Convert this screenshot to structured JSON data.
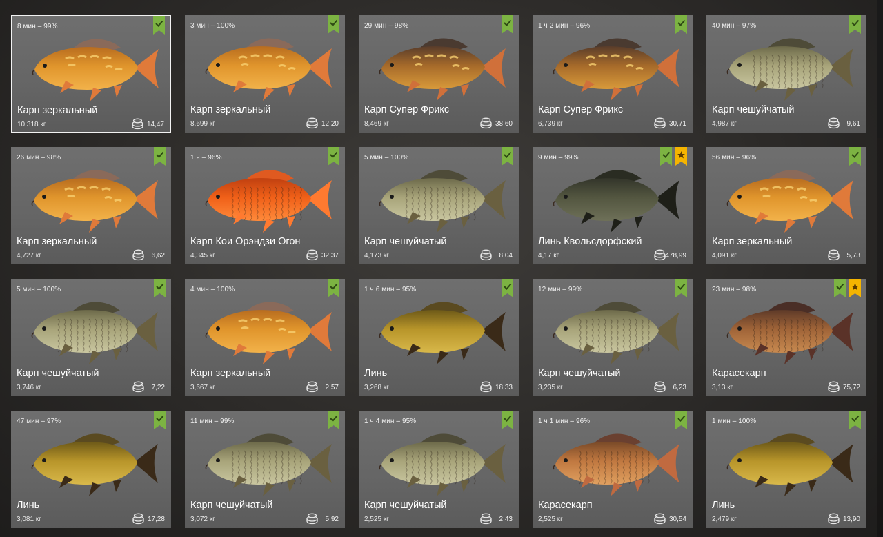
{
  "colors": {
    "card_bg": "#6a6a6a",
    "badge_green": "#7cb342",
    "badge_gold": "#f5b400",
    "selected_border": "#f2f2f2"
  },
  "cards": [
    {
      "time": "8 мин – 99%",
      "name": "Карп зеркальный",
      "weight": "10,318 кг",
      "price": "14,47",
      "fish_type": "mirror",
      "badges": [
        "check-icon"
      ],
      "selected": true
    },
    {
      "time": "3 мин – 100%",
      "name": "Карп зеркальный",
      "weight": "8,699 кг",
      "price": "12,20",
      "fish_type": "mirror",
      "badges": [
        "check-icon"
      ]
    },
    {
      "time": "29 мин – 98%",
      "name": "Карп Супер Фрикс",
      "weight": "8,469 кг",
      "price": "38,60",
      "fish_type": "freaks",
      "badges": [
        "check-icon"
      ]
    },
    {
      "time": "1 ч 2 мин – 96%",
      "name": "Карп Супер Фрикс",
      "weight": "6,739 кг",
      "price": "30,71",
      "fish_type": "freaks",
      "badges": [
        "check-icon"
      ]
    },
    {
      "time": "40 мин – 97%",
      "name": "Карп чешуйчатый",
      "weight": "4,987 кг",
      "price": "9,61",
      "fish_type": "scaled",
      "badges": [
        "check-icon"
      ]
    },
    {
      "time": "26 мин – 98%",
      "name": "Карп зеркальный",
      "weight": "4,727 кг",
      "price": "6,62",
      "fish_type": "mirror",
      "badges": [
        "check-icon"
      ]
    },
    {
      "time": "1 ч – 96%",
      "name": "Карп Кои Орэндзи Огон",
      "weight": "4,345 кг",
      "price": "32,37",
      "fish_type": "koi",
      "badges": [
        "check-icon"
      ]
    },
    {
      "time": "5 мин – 100%",
      "name": "Карп чешуйчатый",
      "weight": "4,173 кг",
      "price": "8,04",
      "fish_type": "scaled",
      "badges": [
        "check-icon"
      ]
    },
    {
      "time": "9 мин – 99%",
      "name": "Линь Квольсдорфский",
      "weight": "4,17 кг",
      "price": "478,99",
      "fish_type": "tench_dark",
      "badges": [
        "check-icon",
        "star-icon"
      ]
    },
    {
      "time": "56 мин – 96%",
      "name": "Карп зеркальный",
      "weight": "4,091 кг",
      "price": "5,73",
      "fish_type": "mirror",
      "badges": [
        "check-icon"
      ]
    },
    {
      "time": "5 мин – 100%",
      "name": "Карп чешуйчатый",
      "weight": "3,746 кг",
      "price": "7,22",
      "fish_type": "scaled",
      "badges": [
        "check-icon"
      ]
    },
    {
      "time": "4 мин – 100%",
      "name": "Карп зеркальный",
      "weight": "3,667 кг",
      "price": "2,57",
      "fish_type": "mirror",
      "badges": [
        "check-icon"
      ]
    },
    {
      "time": "1 ч 6 мин – 95%",
      "name": "Линь",
      "weight": "3,268 кг",
      "price": "18,33",
      "fish_type": "tench",
      "badges": [
        "check-icon"
      ]
    },
    {
      "time": "12 мин – 99%",
      "name": "Карп чешуйчатый",
      "weight": "3,235 кг",
      "price": "6,23",
      "fish_type": "scaled",
      "badges": [
        "check-icon"
      ]
    },
    {
      "time": "23 мин – 98%",
      "name": "Карасекарп",
      "weight": "3,13 кг",
      "price": "75,72",
      "fish_type": "crucian_dark",
      "badges": [
        "check-icon",
        "star-icon"
      ]
    },
    {
      "time": "47 мин – 97%",
      "name": "Линь",
      "weight": "3,081 кг",
      "price": "17,28",
      "fish_type": "tench",
      "badges": [
        "check-icon"
      ]
    },
    {
      "time": "11 мин – 99%",
      "name": "Карп чешуйчатый",
      "weight": "3,072 кг",
      "price": "5,92",
      "fish_type": "scaled",
      "badges": [
        "check-icon"
      ]
    },
    {
      "time": "1 ч 4 мин – 95%",
      "name": "Карп чешуйчатый",
      "weight": "2,525 кг",
      "price": "2,43",
      "fish_type": "scaled",
      "badges": [
        "check-icon"
      ]
    },
    {
      "time": "1 ч 1 мин – 96%",
      "name": "Карасекарп",
      "weight": "2,525 кг",
      "price": "30,54",
      "fish_type": "crucian",
      "badges": [
        "check-icon"
      ]
    },
    {
      "time": "1 мин – 100%",
      "name": "Линь",
      "weight": "2,479 кг",
      "price": "13,90",
      "fish_type": "tench",
      "badges": [
        "check-icon"
      ]
    }
  ]
}
